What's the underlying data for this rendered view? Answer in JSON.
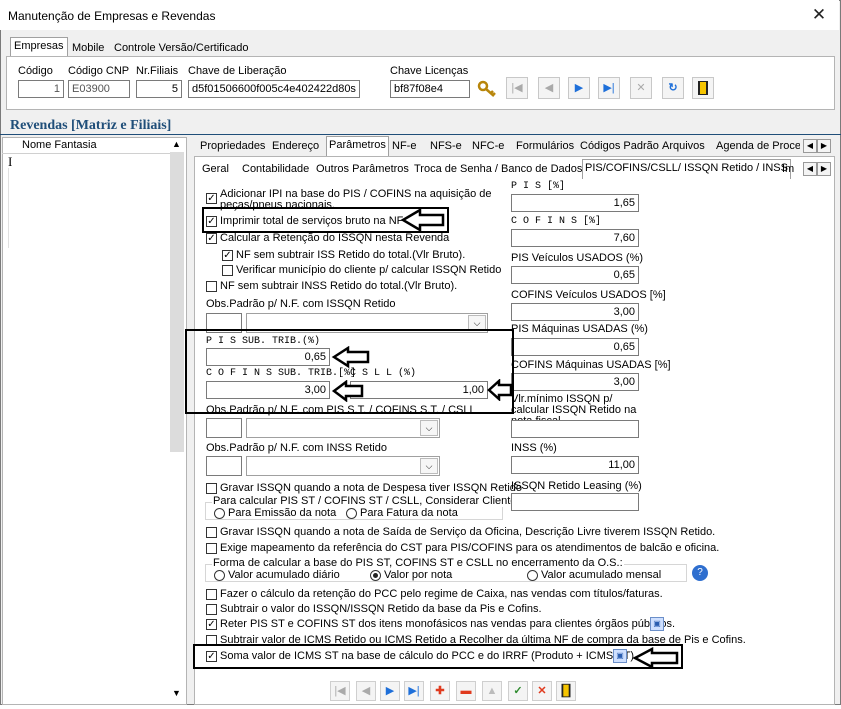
{
  "window": {
    "title": "Manutenção de Empresas e Revendas",
    "close": "✕"
  },
  "top_tabs": [
    "Empresas",
    "Mobile",
    "Controle Versão/Certificado"
  ],
  "header": {
    "codigo_label": "Código",
    "codigo_value": "1",
    "codigo_cnp_label": "Código CNP",
    "codigo_cnp_value": "E03900",
    "nr_filiais_label": "Nr.Filiais",
    "nr_filiais_value": "5",
    "chave_liberacao_label": "Chave de Liberação",
    "chave_liberacao_value": "d5f01506600f005c4e402422d80s",
    "chave_licencas_label": "Chave Licenças",
    "chave_licencas_value": "bf87f08e4"
  },
  "section_title": "Revendas [Matriz e Filiais]",
  "list": {
    "header": "Nome Fantasia",
    "cursor": "I"
  },
  "main_tabs": [
    "Propriedades",
    "Endereço",
    "Parâmetros",
    "NF-e",
    "NFS-e",
    "NFC-e",
    "Formulários",
    "Códigos Padrão",
    "Arquivos",
    "Agenda de Proce:"
  ],
  "sub_tabs": [
    "Geral",
    "Contabilidade",
    "Outros Parâmetros",
    "Troca de Senha / Banco de Dados",
    "PIS/COFINS/CSLL/ ISSQN Retido / INSS",
    "Im"
  ],
  "options": {
    "adicionar_ipi": "Adicionar IPI na base do PIS / COFINS na aquisição de peças/pneus nacionais.",
    "imprimir_total": "Imprimir total de serviços bruto na NF",
    "calcular_retencao": "Calcular a Retenção do ISSQN nesta Revenda",
    "nf_sem_subtrair_iss": "NF sem subtrair ISS Retido do total.(Vlr Bruto).",
    "verificar_municipio": "Verificar município do cliente p/ calcular ISSQN Retido",
    "nf_sem_subtrair_inss": "NF sem subtrair INSS Retido do total.(Vlr Bruto).",
    "obs_issqn_label": "Obs.Padrão p/ N.F. com ISSQN Retido",
    "pis_sub_trib_label": "P I S  SUB. TRIB.(%)",
    "pis_sub_trib_value": "0,65",
    "cofins_sub_trib_label": "C O F I N S  SUB. TRIB.[%]",
    "cofins_sub_trib_value": "3,00",
    "csll_label": "C S L L  (%)",
    "csll_value": "1,00",
    "obs_pis_st_label": "Obs.Padrão p/ N.F. com PIS S.T. / COFINS S.T. / CSLL",
    "obs_inss_label": "Obs.Padrão p/ N.F. com INSS Retido",
    "gravar_issqn_despesa": "Gravar ISSQN quando a nota de Despesa tiver ISSQN Retido",
    "calc_group_label": "Para calcular PIS ST / COFINS ST / CSLL, Considerar Cliente:",
    "radio_emissao": "Para Emissão da nota",
    "radio_fatura": "Para Fatura da nota",
    "gravar_issqn_saida": "Gravar ISSQN quando a nota de Saída de Serviço da Oficina, Descrição Livre tiverem ISSQN Retido.",
    "exige_mapeamento": "Exige mapeamento da referência do CST para PIS/COFINS para os atendimentos de balcão e oficina.",
    "forma_group_label": "Forma de calcular a base do PIS ST, COFINS ST e CSLL no encerramento da O.S.:",
    "radio_acum_diario": "Valor acumulado diário",
    "radio_por_nota": "Valor por nota",
    "radio_acum_mensal": "Valor acumulado mensal",
    "fazer_calculo_pcc": "Fazer o cálculo da retenção do PCC pelo regime de Caixa, nas vendas com títulos/faturas.",
    "subtrair_issqn": "Subtrair o valor do ISSQN/ISSQN Retido da base da Pis e Cofins.",
    "reter_pis_cofins": "Reter PIS ST e COFINS ST dos itens monofásicos nas vendas para clientes órgãos públicos.",
    "subtrair_icms": "Subtrair valor de ICMS Retido ou ICMS Retido a Recolher da última NF de compra da base de Pis e Cofins.",
    "soma_icms_st": "Soma valor de ICMS ST na base de cálculo do PCC e do IRRF (Produto + ICMS ST)"
  },
  "right_fields": {
    "pis_label": "P I S  [%]",
    "pis_value": "1,65",
    "cofins_label": "C O F I N S  [%]",
    "cofins_value": "7,60",
    "pis_veic_label": "PIS Veículos  USADOS (%)",
    "pis_veic_value": "0,65",
    "cofins_veic_label": "COFINS Veículos  USADOS [%]",
    "cofins_veic_value": "3,00",
    "pis_maq_label": "PIS Máquinas  USADAS (%)",
    "pis_maq_value": "0,65",
    "cofins_maq_label": "COFINS Máquinas USADAS [%]",
    "cofins_maq_value": "3,00",
    "vlr_minimo_label": "Vlr.mínimo ISSQN p/ calcular ISSQN Retido na nota fiscal.",
    "vlr_minimo_value": "",
    "inss_label": "INSS (%)",
    "inss_value": "11,00",
    "issqn_leasing_label": "ISSQN Retido Leasing (%)",
    "issqn_leasing_value": ""
  },
  "colors": {
    "section_title": "#1f4e79",
    "nav_blue": "#1e6fd9",
    "add_red": "#e03a1e",
    "save_green": "#2e8b2e",
    "highlight_box": "#000000"
  }
}
